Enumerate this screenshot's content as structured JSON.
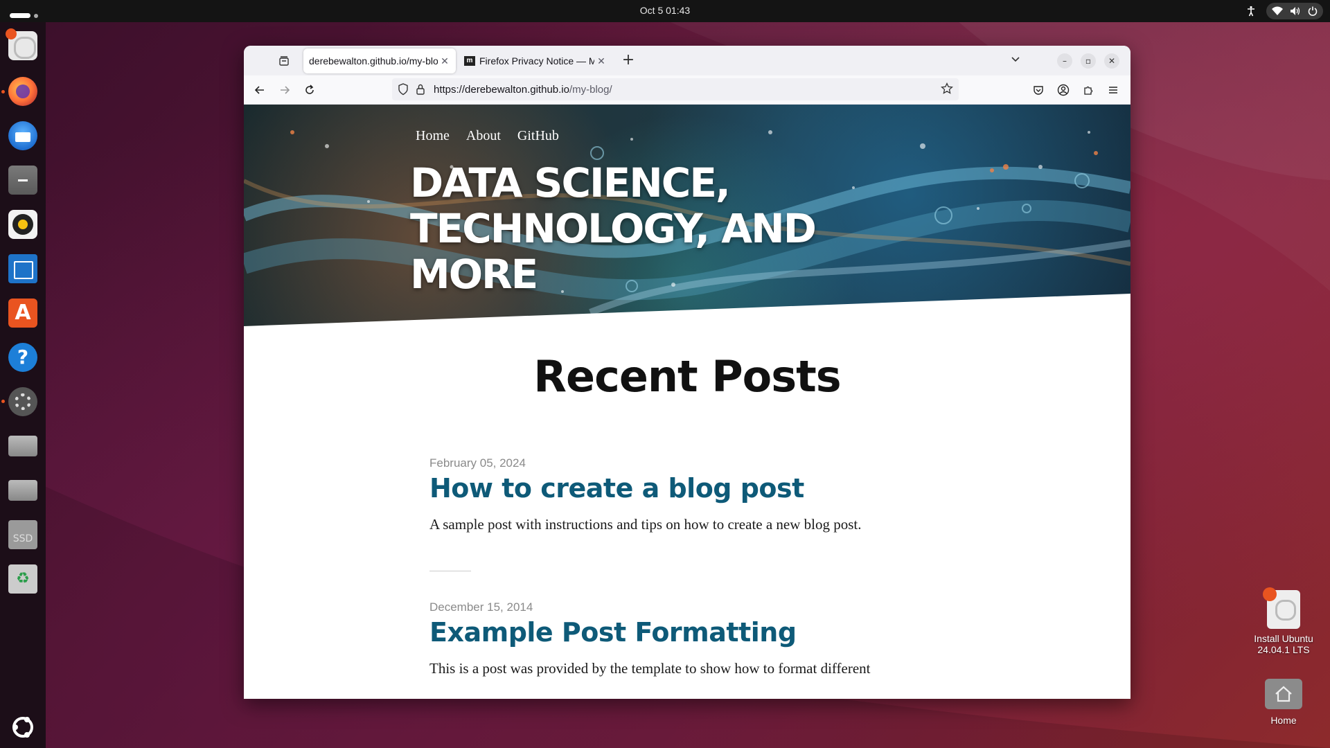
{
  "topbar": {
    "clock": "Oct 5  01:43"
  },
  "dock": {
    "items": [
      "Install Ubuntu",
      "Firefox",
      "Thunderbird",
      "Files",
      "Rhythmbox",
      "LibreOffice Writer",
      "App Center",
      "Help",
      "Settings",
      "Drive 1",
      "Drive 2",
      "SSD",
      "Trash",
      "Show Apps"
    ],
    "ssd_label": "SSD"
  },
  "desktop": {
    "install_label": "Install Ubuntu 24.04.1 LTS",
    "home_label": "Home"
  },
  "browser": {
    "tabs": [
      {
        "title": "derebewalton.github.io/my-blog/",
        "active": true
      },
      {
        "title": "Firefox Privacy Notice — Mozilla",
        "active": false
      }
    ],
    "url_host": "https://derebewalton.github.io",
    "url_path": "/my-blog/"
  },
  "site": {
    "nav": [
      "Home",
      "About",
      "GitHub"
    ],
    "hero_title": "Data Science, Technology, and More",
    "section_heading": "Recent Posts",
    "posts": [
      {
        "date": "February 05, 2024",
        "title": "How to create a blog post",
        "excerpt": "A sample post with instructions and tips on how to create a new blog post."
      },
      {
        "date": "December 15, 2014",
        "title": "Example Post Formatting",
        "excerpt": "This is a post was provided by the template to show how to format different"
      }
    ]
  },
  "colors": {
    "accent": "#e95420",
    "post_title": "#0e5a78"
  }
}
